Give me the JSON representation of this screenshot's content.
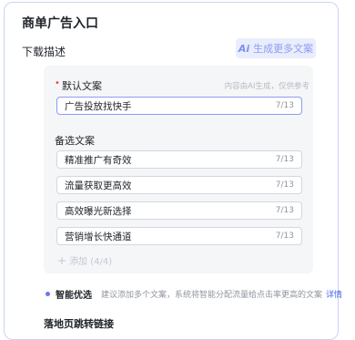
{
  "panel": {
    "title": "商单广告入口"
  },
  "description": {
    "label": "下载描述",
    "generate_button": {
      "icon": "Ai",
      "label": "生成更多文案"
    }
  },
  "default_copy": {
    "required_mark": "•",
    "label": "默认文案",
    "hint": "内容由AI生成，仅供参考",
    "value": "广告投放找快手",
    "count": "7/13"
  },
  "alternatives": {
    "label": "备选文案",
    "items": [
      {
        "value": "精准推广有奇效",
        "count": "7/13"
      },
      {
        "value": "流量获取更高效",
        "count": "7/13"
      },
      {
        "value": "高效曝光新选择",
        "count": "7/13"
      },
      {
        "value": "营销增长快通道",
        "count": "7/13"
      }
    ],
    "add_icon": "+",
    "add_label": "添加 (4/4)"
  },
  "smart": {
    "title": "智能优选",
    "text": "建议添加多个文案，系统将智能分配流量给点击率更高的文案",
    "link": "详情"
  },
  "landing": {
    "label": "落地页跳转链接"
  },
  "colors": {
    "accent": "#6a78e8",
    "required": "#e5484d",
    "link": "#4766e8"
  }
}
